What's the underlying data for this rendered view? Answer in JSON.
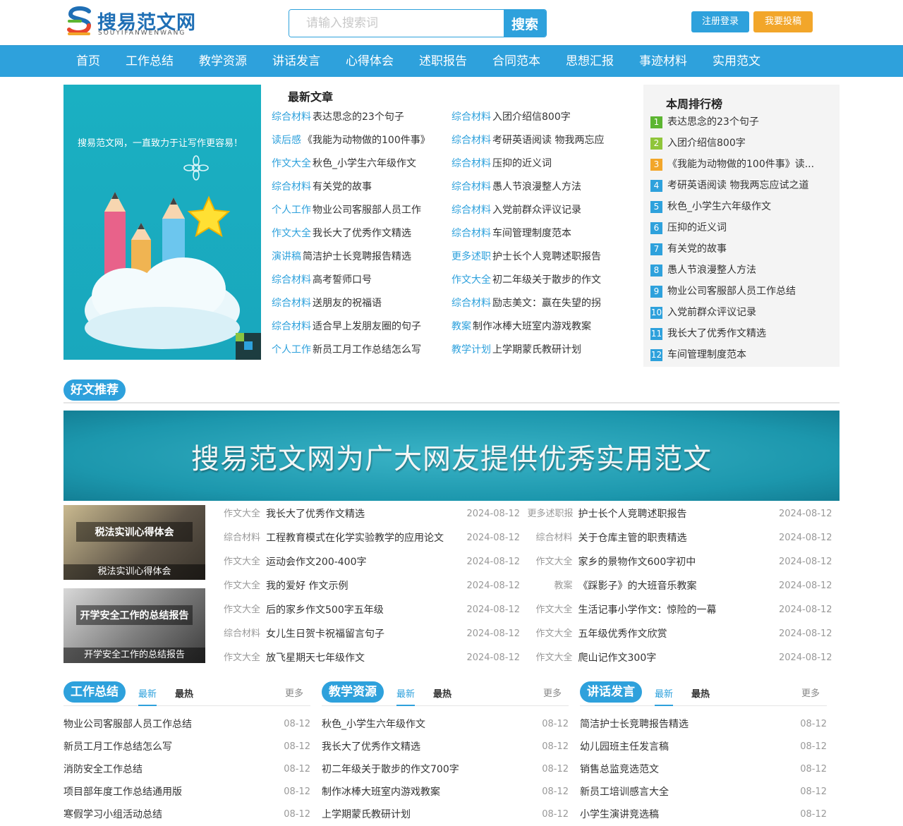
{
  "header": {
    "logo_title": "搜易范文网",
    "logo_sub": "SOUYIFANWENWANG",
    "search_placeholder": "请输入搜索词",
    "search_button": "搜索",
    "register_label": "注册登录",
    "post_label": "我要投稿"
  },
  "nav": [
    "首页",
    "工作总结",
    "教学资源",
    "讲话发言",
    "心得体会",
    "述职报告",
    "合同范本",
    "思想汇报",
    "事迹材料",
    "实用范文"
  ],
  "banner": {
    "text": "搜易范文网，一直致力于让写作更容易！"
  },
  "latest": {
    "title": "最新文章",
    "rows": [
      [
        {
          "tag": "综合材料",
          "title": "表达思念的23个句子"
        },
        {
          "tag": "综合材料",
          "title": "入团介绍信800字"
        }
      ],
      [
        {
          "tag": "读后感",
          "title": "《我能为动物做的100件事》"
        },
        {
          "tag": "综合材料",
          "title": "考研英语阅读 物我两忘应"
        }
      ],
      [
        {
          "tag": "作文大全",
          "title": "秋色_小学生六年级作文"
        },
        {
          "tag": "综合材料",
          "title": "压抑的近义词"
        }
      ],
      [
        {
          "tag": "综合材料",
          "title": "有关党的故事"
        },
        {
          "tag": "综合材料",
          "title": "愚人节浪漫整人方法"
        }
      ],
      [
        {
          "tag": "个人工作",
          "title": "物业公司客服部人员工作"
        },
        {
          "tag": "综合材料",
          "title": "入党前群众评议记录"
        }
      ],
      [
        {
          "tag": "作文大全",
          "title": "我长大了优秀作文精选"
        },
        {
          "tag": "综合材料",
          "title": "车间管理制度范本"
        }
      ],
      [
        {
          "tag": "演讲稿",
          "title": "简洁护士长竞聘报告精选"
        },
        {
          "tag": "更多述职",
          "title": "护士长个人竞聘述职报告"
        }
      ],
      [
        {
          "tag": "综合材料",
          "title": "高考誓师口号"
        },
        {
          "tag": "作文大全",
          "title": "初二年级关于散步的作文"
        }
      ],
      [
        {
          "tag": "综合材料",
          "title": "送朋友的祝福语"
        },
        {
          "tag": "综合材料",
          "title": "励志美文：赢在失望的拐"
        }
      ],
      [
        {
          "tag": "综合材料",
          "title": "适合早上发朋友圈的句子"
        },
        {
          "tag": "教案",
          "title": "制作冰棒大班室内游戏教案"
        }
      ],
      [
        {
          "tag": "个人工作",
          "title": "新员工月工作总结怎么写"
        },
        {
          "tag": "教学计划",
          "title": "上学期蒙氏教研计划"
        }
      ]
    ]
  },
  "ranking": {
    "title": "本周排行榜",
    "items": [
      {
        "n": "1",
        "color": "#5cb531",
        "title": "表达思念的23个句子"
      },
      {
        "n": "2",
        "color": "#8fc53a",
        "title": "入团介绍信800字"
      },
      {
        "n": "3",
        "color": "#f2a62a",
        "title": "《我能为动物做的100件事》读..."
      },
      {
        "n": "4",
        "color": "#2ea1dc",
        "title": "考研英语阅读 物我两忘应试之道"
      },
      {
        "n": "5",
        "color": "#2ea1dc",
        "title": "秋色_小学生六年级作文"
      },
      {
        "n": "6",
        "color": "#2ea1dc",
        "title": "压抑的近义词"
      },
      {
        "n": "7",
        "color": "#2ea1dc",
        "title": "有关党的故事"
      },
      {
        "n": "8",
        "color": "#2ea1dc",
        "title": "愚人节浪漫整人方法"
      },
      {
        "n": "9",
        "color": "#2ea1dc",
        "title": "物业公司客服部人员工作总结"
      },
      {
        "n": "10",
        "color": "#2ea1dc",
        "title": "入党前群众评议记录"
      },
      {
        "n": "11",
        "color": "#2ea1dc",
        "title": "我长大了优秀作文精选"
      },
      {
        "n": "12",
        "color": "#2ea1dc",
        "title": "车间管理制度范本"
      }
    ]
  },
  "recommend": {
    "title": "好文推荐",
    "banner_text": "搜易范文网为广大网友提供优秀实用范文",
    "thumbs": [
      {
        "caption": "税法实训心得体会",
        "sub": "税法实训心得体会"
      },
      {
        "caption": "开学安全工作的总结报告",
        "sub": "开学安全工作的总结报告"
      }
    ],
    "rows": [
      [
        {
          "cat": "作文大全",
          "title": "我长大了优秀作文精选",
          "date": "2024-08-12"
        },
        {
          "cat": "更多述职报",
          "title": "护士长个人竞聘述职报告",
          "date": "2024-08-12"
        }
      ],
      [
        {
          "cat": "综合材料",
          "title": "工程教育模式在化学实验教学的应用论文",
          "date": "2024-08-12"
        },
        {
          "cat": "综合材料",
          "title": "关于仓库主管的职责精选",
          "date": "2024-08-12"
        }
      ],
      [
        {
          "cat": "作文大全",
          "title": "运动会作文200-400字",
          "date": "2024-08-12"
        },
        {
          "cat": "作文大全",
          "title": "家乡的景物作文600字初中",
          "date": "2024-08-12"
        }
      ],
      [
        {
          "cat": "作文大全",
          "title": "我的爱好 作文示例",
          "date": "2024-08-12"
        },
        {
          "cat": "教案",
          "title": "《踩影子》的大班音乐教案",
          "date": "2024-08-12"
        }
      ],
      [
        {
          "cat": "作文大全",
          "title": "后的家乡作文500字五年级",
          "date": "2024-08-12"
        },
        {
          "cat": "作文大全",
          "title": "生活记事小学作文：惊险的一幕",
          "date": "2024-08-12"
        }
      ],
      [
        {
          "cat": "综合材料",
          "title": "女儿生日贺卡祝福留言句子",
          "date": "2024-08-12"
        },
        {
          "cat": "作文大全",
          "title": "五年级优秀作文欣赏",
          "date": "2024-08-12"
        }
      ],
      [
        {
          "cat": "作文大全",
          "title": "放飞星期天七年级作文",
          "date": "2024-08-12"
        },
        {
          "cat": "作文大全",
          "title": "爬山记作文300字",
          "date": "2024-08-12"
        }
      ]
    ]
  },
  "columns": [
    {
      "title": "工作总结",
      "tab_new": "最新",
      "tab_hot": "最热",
      "more": "更多",
      "items": [
        {
          "title": "物业公司客服部人员工作总结",
          "date": "08-12"
        },
        {
          "title": "新员工月工作总结怎么写",
          "date": "08-12"
        },
        {
          "title": "消防安全工作总结",
          "date": "08-12"
        },
        {
          "title": "项目部年度工作总结通用版",
          "date": "08-12"
        },
        {
          "title": "寒假学习小组活动总结",
          "date": "08-12"
        }
      ]
    },
    {
      "title": "教学资源",
      "tab_new": "最新",
      "tab_hot": "最热",
      "more": "更多",
      "items": [
        {
          "title": "秋色_小学生六年级作文",
          "date": "08-12"
        },
        {
          "title": "我长大了优秀作文精选",
          "date": "08-12"
        },
        {
          "title": "初二年级关于散步的作文700字",
          "date": "08-12"
        },
        {
          "title": "制作冰棒大班室内游戏教案",
          "date": "08-12"
        },
        {
          "title": "上学期蒙氏教研计划",
          "date": "08-12"
        }
      ]
    },
    {
      "title": "讲话发言",
      "tab_new": "最新",
      "tab_hot": "最热",
      "more": "更多",
      "items": [
        {
          "title": "简洁护士长竞聘报告精选",
          "date": "08-12"
        },
        {
          "title": "幼儿园班主任发言稿",
          "date": "08-12"
        },
        {
          "title": "销售总监竞选范文",
          "date": "08-12"
        },
        {
          "title": "新员工培训感言大全",
          "date": "08-12"
        },
        {
          "title": "小学生演讲竞选稿",
          "date": "08-12"
        }
      ]
    }
  ]
}
